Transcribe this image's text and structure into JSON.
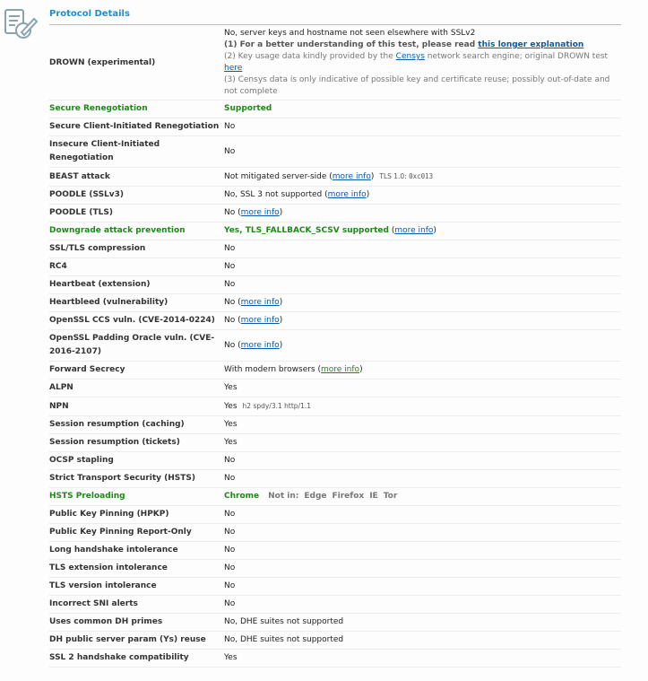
{
  "section_title": "Protocol Details",
  "colors": {
    "accent": "#1d8fcf",
    "good": "#1c8a14",
    "link": "#0b5aa8"
  },
  "drown": {
    "label": "DROWN (experimental)",
    "line1": "No, server keys and hostname not seen elsewhere with SSLv2",
    "note1_prefix": "(1) For a better understanding of this test, please read ",
    "note1_link": "this longer explanation",
    "note2_prefix": "(2) Key usage data kindly provided by the ",
    "note2_link": "Censys",
    "note2_suffix": " network search engine; original DROWN test ",
    "note2_link2": "here",
    "note3": "(3) Censys data is only indicative of possible key and certificate reuse; possibly out-of-date and not complete"
  },
  "rows": {
    "reneg": {
      "label": "Secure Renegotiation",
      "value": "Supported"
    },
    "sec_client_reneg": {
      "label": "Secure Client-Initiated Renegotiation",
      "value": "No"
    },
    "insec_client_reneg": {
      "label": "Insecure Client-Initiated Renegotiation",
      "value": "No"
    },
    "beast": {
      "label": "BEAST attack",
      "value": "Not mitigated server-side (",
      "link": "more info",
      "close": ")",
      "extra": "TLS 1.0: ",
      "extra_code": "0xc013"
    },
    "poodle_ssl": {
      "label": "POODLE (SSLv3)",
      "value": "No, SSL 3 not supported (",
      "link": "more info",
      "close": ")"
    },
    "poodle_tls": {
      "label": "POODLE (TLS)",
      "value": "No (",
      "link": "more info",
      "close": ")"
    },
    "downgrade": {
      "label": "Downgrade attack prevention",
      "value": "Yes, TLS_FALLBACK_SCSV supported",
      "open": " (",
      "link": "more info",
      "close": ")"
    },
    "compression": {
      "label": "SSL/TLS compression",
      "value": "No"
    },
    "rc4": {
      "label": "RC4",
      "value": "No"
    },
    "heartbeat": {
      "label": "Heartbeat (extension)",
      "value": "No"
    },
    "heartbleed": {
      "label": "Heartbleed (vulnerability)",
      "value": "No (",
      "link": "more info",
      "close": ")"
    },
    "ccs": {
      "label": "OpenSSL CCS vuln. (CVE-2014-0224)",
      "value": "No (",
      "link": "more info",
      "close": ")"
    },
    "padding": {
      "label": "OpenSSL Padding Oracle vuln. (CVE-2016-2107)",
      "value": "No (",
      "link": "more info",
      "close": ")"
    },
    "fs": {
      "label": "Forward Secrecy",
      "value": "With modern browsers (",
      "link": "more info",
      "close": ")"
    },
    "alpn": {
      "label": "ALPN",
      "value": "Yes"
    },
    "npn": {
      "label": "NPN",
      "value": "Yes",
      "extra": "h2 spdy/3.1 http/1.1"
    },
    "sess_cache": {
      "label": "Session resumption (caching)",
      "value": "Yes"
    },
    "sess_tickets": {
      "label": "Session resumption (tickets)",
      "value": "Yes"
    },
    "ocsp": {
      "label": "OCSP stapling",
      "value": "No"
    },
    "hsts": {
      "label": "Strict Transport Security (HSTS)",
      "value": "No"
    },
    "hsts_preload": {
      "label": "HSTS Preloading",
      "value": "Chrome",
      "notin_label": "Not in:",
      "notin": [
        "Edge",
        "Firefox",
        "IE",
        "Tor"
      ]
    },
    "hpkp": {
      "label": "Public Key Pinning (HPKP)",
      "value": "No"
    },
    "hpkp_ro": {
      "label": "Public Key Pinning Report-Only",
      "value": "No"
    },
    "long_hs": {
      "label": "Long handshake intolerance",
      "value": "No"
    },
    "ext_intol": {
      "label": "TLS extension intolerance",
      "value": "No"
    },
    "ver_intol": {
      "label": "TLS version intolerance",
      "value": "No"
    },
    "sni": {
      "label": "Incorrect SNI alerts",
      "value": "No"
    },
    "dh_primes": {
      "label": "Uses common DH primes",
      "value": "No, DHE suites not supported"
    },
    "dh_reuse": {
      "label": "DH public server param (Ys) reuse",
      "value": "No, DHE suites not supported"
    },
    "ssl2": {
      "label": "SSL 2 handshake compatibility",
      "value": "Yes"
    }
  }
}
